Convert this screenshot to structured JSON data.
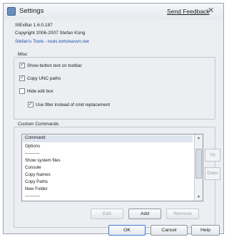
{
  "window": {
    "title": "Settings",
    "feedback_link": "Send Feedback",
    "close_glyph": "✕"
  },
  "info": {
    "version": "StExBar 1.6.0.187",
    "copyright": "Copyright 2006-2007 Stefan Küng",
    "tools_link": "Stefan's Tools - tools.tortoisesvn.net"
  },
  "misc": {
    "label": "Misc",
    "options": [
      {
        "label": "Show button text on toolbar",
        "checked": true
      },
      {
        "label": "Copy UNC paths",
        "checked": true
      },
      {
        "label": "Hide edit box",
        "checked": false
      },
      {
        "label": "Use filter instead of cmd replacement",
        "checked": true
      }
    ]
  },
  "custom_commands": {
    "label": "Custom Commands",
    "header": "Command",
    "items": [
      "Options",
      "----------",
      "Show system files",
      "Console",
      "Copy Names",
      "Copy Paths",
      "New Folder",
      "----------"
    ],
    "up_label": "Up",
    "down_label": "Down",
    "edit_label": "Edit",
    "add_label": "Add",
    "remove_label": "Remove"
  },
  "footer": {
    "ok_label": "OK",
    "cancel_label": "Cancel",
    "help_label": "Help"
  }
}
